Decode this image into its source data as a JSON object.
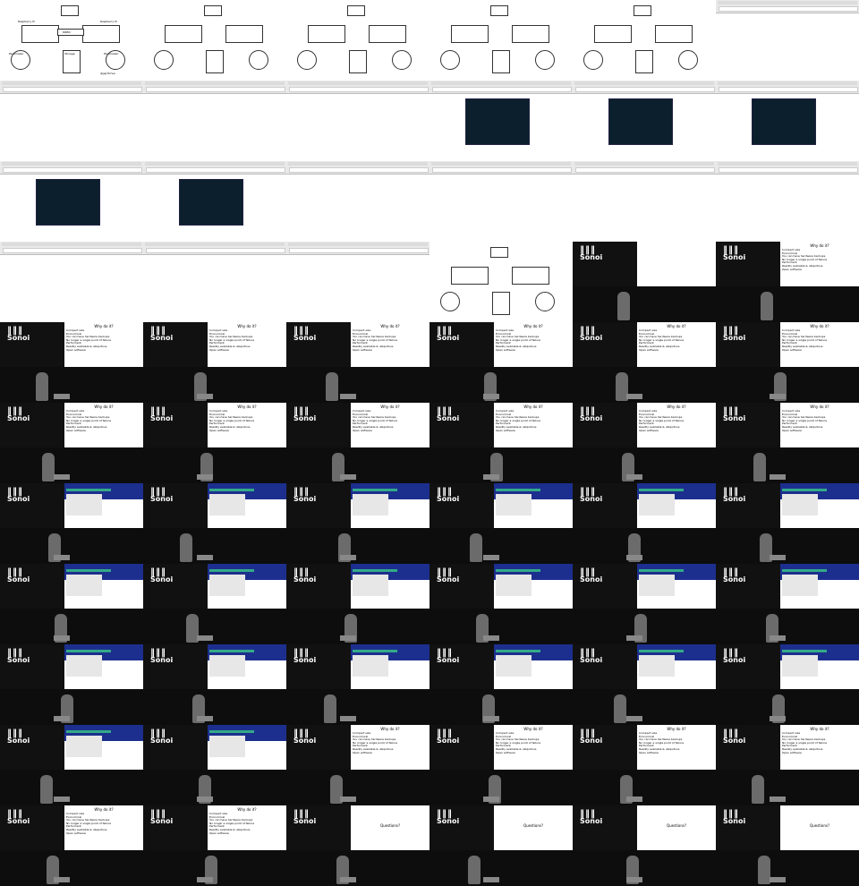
{
  "diagram": {
    "labels": {
      "top_left": "Raspberry Pi",
      "top_right": "Raspberry Pi",
      "center": "DRBD",
      "bottom_left": "Pacemaker",
      "bottom_center": "Storage",
      "bottom_right": "Pacemaker",
      "footer": "@jwj7b7ea"
    }
  },
  "browser": {
    "url": "Terminal"
  },
  "talk_slide": {
    "title": "Why do it?",
    "bullets": [
      "Compact size",
      "Economical",
      "You can have hardware backups",
      "No longer a single point of failure",
      "Performant",
      "Readily available & ubiquitous",
      "Open software"
    ],
    "questions": "Questions?"
  },
  "branding": {
    "logo_text": "Sonoi",
    "logo_sub": "conventio"
  }
}
